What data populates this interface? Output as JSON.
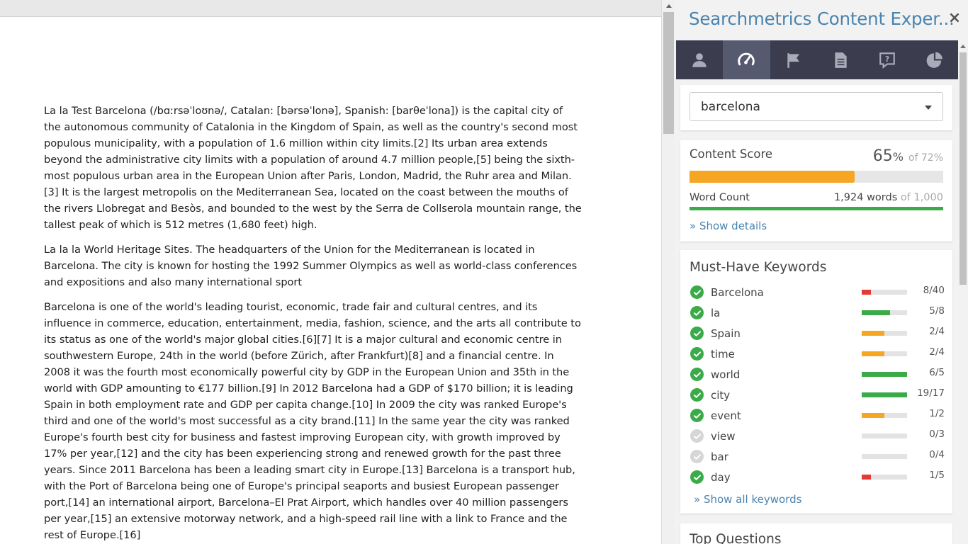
{
  "document": {
    "paragraphs": [
      "La la Test Barcelona (/bɑːrsəˈloʊnə/, Catalan: [bərsəˈlonə], Spanish: [barθeˈlona]) is the capital city of the autonomous community of Catalonia in the Kingdom of Spain, as well as the country's second most populous municipality, with a population of 1.6 million within city limits.[2] Its urban area extends beyond the administrative city limits with a population of around 4.7 million people,[5] being the sixth-most populous urban area in the European Union after Paris, London, Madrid, the Ruhr area and Milan.[3] It is the largest metropolis on the Mediterranean Sea, located on the coast between the mouths of the rivers Llobregat and Besòs, and bounded to the west by the Serra de Collserola mountain range, the tallest peak of which is 512 metres (1,680 feet) high.",
      "La la la World Heritage Sites. The headquarters of the Union for the Mediterranean is located in Barcelona. The city is known for hosting the 1992 Summer Olympics as well as world-class conferences and expositions and also many international sport",
      "Barcelona is one of the world's leading tourist, economic, trade fair and cultural centres, and its influence in commerce, education, entertainment, media, fashion, science, and the arts all contribute to its status as one of the world's major global cities.[6][7] It is a major cultural and economic centre in southwestern Europe, 24th in the world (before Zürich, after Frankfurt)[8] and a financial centre. In 2008 it was the fourth most economically powerful city by GDP in the European Union and 35th in the world with GDP amounting to €177 billion.[9] In 2012 Barcelona had a GDP of $170 billion; it is leading Spain in both employment rate and GDP per capita change.[10] In 2009 the city was ranked Europe's third and one of the world's most successful as a city brand.[11] In the same year the city was ranked Europe's fourth best city for business and fastest improving European city, with growth improved by 17% per year,[12] and the city has been experiencing strong and renewed growth for the past three years. Since 2011 Barcelona has been a leading smart city in Europe.[13] Barcelona is a transport hub, with the Port of Barcelona being one of Europe's principal seaports and busiest European passenger port,[14] an international airport, Barcelona–El Prat Airport, which handles over 40 million passengers per year,[15] an extensive motorway network, and a high-speed rail line with a link to France and the rest of Europe.[16]"
    ]
  },
  "panel": {
    "title": "Searchmetrics Content Exper...",
    "close_label": "×",
    "tabs": [
      {
        "icon": "user-icon",
        "active": false
      },
      {
        "icon": "speedometer-icon",
        "active": true
      },
      {
        "icon": "flag-icon",
        "active": false
      },
      {
        "icon": "document-icon",
        "active": false
      },
      {
        "icon": "question-icon",
        "active": false
      },
      {
        "icon": "pie-chart-icon",
        "active": false
      }
    ],
    "keyword_select": {
      "value": "barcelona"
    },
    "content_score": {
      "label": "Content Score",
      "value": "65",
      "unit": "%",
      "target": "of 72%",
      "fill_percent": 65,
      "color": "#f5a623"
    },
    "word_count": {
      "label": "Word Count",
      "value": "1,924 words",
      "target": "of 1,000",
      "fill_percent": 100,
      "color": "#3bab4a"
    },
    "show_details_label": "» Show details",
    "keywords": {
      "title": "Must-Have Keywords",
      "items": [
        {
          "name": "Barcelona",
          "count": "8/40",
          "fill": 0.2,
          "color": "#e53935",
          "done": true
        },
        {
          "name": "la",
          "count": "5/8",
          "fill": 0.625,
          "color": "#3bab4a",
          "done": true
        },
        {
          "name": "Spain",
          "count": "2/4",
          "fill": 0.5,
          "color": "#f5a623",
          "done": true
        },
        {
          "name": "time",
          "count": "2/4",
          "fill": 0.5,
          "color": "#f5a623",
          "done": true
        },
        {
          "name": "world",
          "count": "6/5",
          "fill": 1.0,
          "color": "#3bab4a",
          "done": true
        },
        {
          "name": "city",
          "count": "19/17",
          "fill": 1.0,
          "color": "#3bab4a",
          "done": true
        },
        {
          "name": "event",
          "count": "1/2",
          "fill": 0.5,
          "color": "#f5a623",
          "done": true
        },
        {
          "name": "view",
          "count": "0/3",
          "fill": 0,
          "color": "#e3e3e3",
          "done": false
        },
        {
          "name": "bar",
          "count": "0/4",
          "fill": 0,
          "color": "#e3e3e3",
          "done": false
        },
        {
          "name": "day",
          "count": "1/5",
          "fill": 0.2,
          "color": "#e53935",
          "done": true
        }
      ],
      "show_all_label": "» Show all keywords"
    },
    "questions": {
      "title": "Top Questions"
    }
  }
}
